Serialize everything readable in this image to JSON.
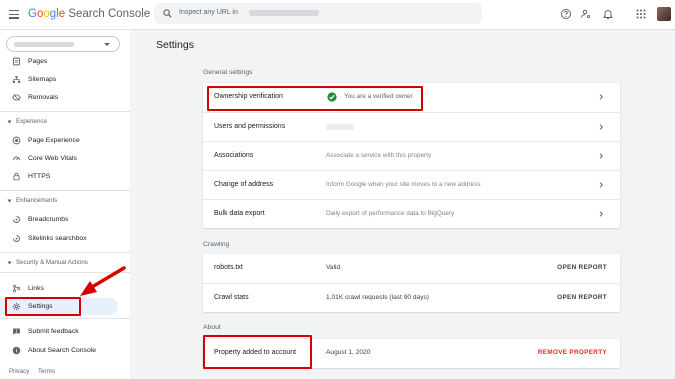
{
  "app": {
    "logo_parts": [
      "G",
      "o",
      "o",
      "g",
      "l",
      "e"
    ],
    "logo_rest": " Search Console"
  },
  "search": {
    "placeholder": "Inspect any URL in"
  },
  "sidebar": {
    "items_top": [
      {
        "label": "Pages",
        "icon": "pages-icon"
      },
      {
        "label": "Sitemaps",
        "icon": "sitemaps-icon"
      },
      {
        "label": "Removals",
        "icon": "removals-icon"
      }
    ],
    "experience_header": "Experience",
    "experience_items": [
      {
        "label": "Page Experience",
        "icon": "page-experience-icon"
      },
      {
        "label": "Core Web Vitals",
        "icon": "core-web-vitals-icon"
      },
      {
        "label": "HTTPS",
        "icon": "lock-icon"
      }
    ],
    "enhancements_header": "Enhancements",
    "enhancement_items": [
      {
        "label": "Breadcrumbs",
        "icon": "breadcrumbs-icon"
      },
      {
        "label": "Sitelinks searchbox",
        "icon": "sitelinks-icon"
      }
    ],
    "security_header": "Security & Manual Actions",
    "bottom_items": [
      {
        "label": "Links",
        "icon": "links-icon"
      },
      {
        "label": "Settings",
        "icon": "gear-icon"
      }
    ],
    "footer_items": [
      {
        "label": "Submit feedback",
        "icon": "feedback-icon"
      },
      {
        "label": "About Search Console",
        "icon": "info-icon"
      }
    ],
    "footer_links": [
      "Privacy",
      "Terms"
    ]
  },
  "main": {
    "title": "Settings",
    "general": {
      "title": "General settings",
      "rows": [
        {
          "name": "Ownership verification",
          "desc": "You are a verified owner"
        },
        {
          "name": "Users and permissions",
          "desc": ""
        },
        {
          "name": "Associations",
          "desc": "Associate a service with this property"
        },
        {
          "name": "Change of address",
          "desc": "Inform Google when your site moves to a new address"
        },
        {
          "name": "Bulk data export",
          "desc": "Daily export of performance data to BigQuery"
        }
      ]
    },
    "crawling": {
      "title": "Crawling",
      "rows": [
        {
          "name": "robots.txt",
          "value": "Valid",
          "action": "OPEN REPORT"
        },
        {
          "name": "Crawl stats",
          "value": "1.01K crawl requests (last 90 days)",
          "action": "OPEN REPORT"
        }
      ]
    },
    "about": {
      "title": "About",
      "rows": [
        {
          "name": "Property added to account",
          "value": "August 1, 2020",
          "action": "REMOVE PROPERTY"
        }
      ]
    }
  },
  "colors": {
    "accent": "#1a73e8",
    "highlight": "#d50000",
    "danger": "#d93025",
    "verified": "#1e8e3e"
  }
}
